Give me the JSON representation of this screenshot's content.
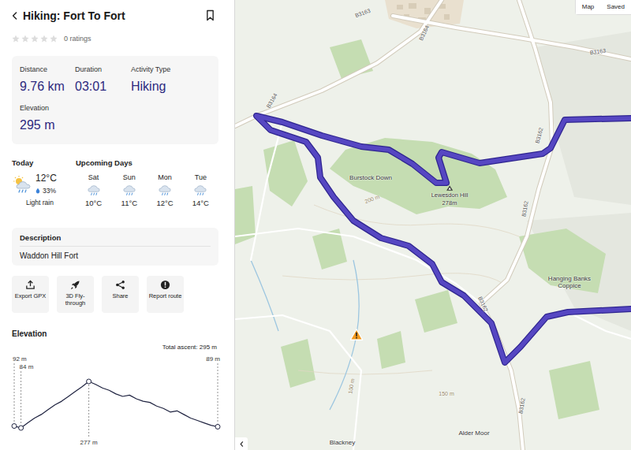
{
  "header": {
    "title": "Hiking: Fort To Fort"
  },
  "rating": {
    "stars": 0,
    "label": "0 ratings"
  },
  "stats": [
    {
      "label": "Distance",
      "value": "9.76 km"
    },
    {
      "label": "Duration",
      "value": "03:01"
    },
    {
      "label": "Activity Type",
      "value": "Hiking"
    },
    {
      "label": "Elevation",
      "value": "295 m"
    }
  ],
  "weather": {
    "today_label": "Today",
    "today": {
      "temp": "12°C",
      "chance": "33%",
      "condition": "Light rain"
    },
    "upcoming_label": "Upcoming Days",
    "days": [
      {
        "day": "Sat",
        "temp": "10°C"
      },
      {
        "day": "Sun",
        "temp": "11°C"
      },
      {
        "day": "Mon",
        "temp": "12°C"
      },
      {
        "day": "Tue",
        "temp": "14°C"
      }
    ]
  },
  "description": {
    "label": "Description",
    "text": "Waddon Hill Fort"
  },
  "actions": [
    {
      "label": "Export GPX",
      "kind": "export"
    },
    {
      "label": "3D Fly-through",
      "kind": "fly"
    },
    {
      "label": "Share",
      "kind": "share"
    },
    {
      "label": "Report route",
      "kind": "report"
    }
  ],
  "elevation": {
    "title": "Elevation",
    "total": "Total ascent: 295 m",
    "values": [
      92,
      84,
      105,
      125,
      140,
      160,
      180,
      195,
      215,
      235,
      255,
      277,
      265,
      250,
      240,
      225,
      215,
      220,
      205,
      195,
      190,
      175,
      165,
      150,
      155,
      140,
      125,
      115,
      105,
      95,
      89
    ],
    "labels": [
      {
        "text": "92 m",
        "index": 0
      },
      {
        "text": "84 m",
        "index": 1
      },
      {
        "text": "277 m",
        "index": 11
      },
      {
        "text": "89 m",
        "index": 30
      }
    ]
  },
  "map": {
    "controls": [
      {
        "label": "Map"
      },
      {
        "label": "Saved"
      }
    ],
    "labels": [
      {
        "text": "B3163",
        "kind": "road"
      },
      {
        "text": "B3164",
        "kind": "road"
      },
      {
        "text": "B3163",
        "kind": "road"
      },
      {
        "text": "B3164",
        "kind": "road"
      },
      {
        "text": "B3162",
        "kind": "road"
      },
      {
        "text": "B3162",
        "kind": "road"
      },
      {
        "text": "B3162",
        "kind": "road"
      },
      {
        "text": "B3162",
        "kind": "road"
      },
      {
        "text": "Burstock Down",
        "kind": "place"
      },
      {
        "text": "Lewesdon Hill",
        "kind": "peak"
      },
      {
        "text": "278m",
        "kind": "height"
      },
      {
        "text": "200 m",
        "kind": "contour"
      },
      {
        "text": "Hanging Banks Coppice",
        "kind": "place"
      },
      {
        "text": "100 m",
        "kind": "contour"
      },
      {
        "text": "150 m",
        "kind": "contour"
      },
      {
        "text": "Blackney",
        "kind": "place"
      },
      {
        "text": "Alder Moor",
        "kind": "place"
      }
    ]
  }
}
